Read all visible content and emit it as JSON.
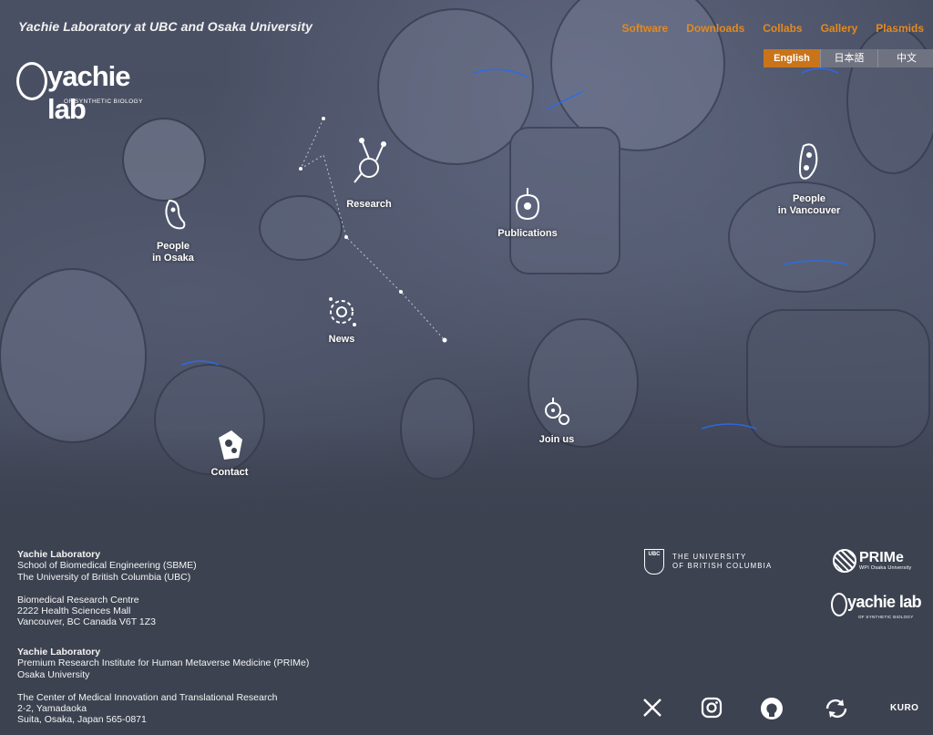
{
  "header": {
    "site_title": "Yachie Laboratory at UBC and Osaka University",
    "logo_word": "yachie lab",
    "logo_sub": "OF SYNTHETIC BIOLOGY"
  },
  "nav": {
    "items": [
      "Software",
      "Downloads",
      "Collabs",
      "Gallery",
      "Plasmids"
    ],
    "accent": "#e38a1f"
  },
  "languages": {
    "items": [
      "English",
      "日本語",
      "中文"
    ],
    "selected": "English"
  },
  "hotspots": {
    "research": "Research",
    "publications": "Publications",
    "people_vancouver_1": "People",
    "people_vancouver_2": "in Vancouver",
    "people_osaka_1": "People",
    "people_osaka_2": "in Osaka",
    "news": "News",
    "join": "Join us",
    "contact": "Contact"
  },
  "footer": {
    "ubc_block": {
      "name": "Yachie Laboratory",
      "line1": "School of Biomedical Engineering (SBME)",
      "line2": "The University of British Columbia (UBC)",
      "line3": "Biomedical Research Centre",
      "line4": "2222 Health Sciences Mall",
      "line5": "Vancouver, BC Canada V6T 1Z3"
    },
    "osaka_block": {
      "name": "Yachie Laboratory",
      "line1": "Premium Research Institute for Human Metaverse Medicine (PRIMe)",
      "line2": "Osaka University",
      "line3": "The Center of Medical Innovation and Translational Research",
      "line4": "2-2, Yamadaoka",
      "line5": "Suita, Osaka, Japan 565-0871"
    },
    "ubc_logo_1": "THE UNIVERSITY",
    "ubc_logo_2": "OF BRITISH COLUMBIA",
    "ubc_shield": "UBC",
    "prime_name": "PRIMe",
    "prime_sub": "WPI Osaka University",
    "lab_logo_word": "yachie lab",
    "lab_logo_sub": "OF SYNTHETIC BIOLOGY",
    "social": [
      "x-icon",
      "instagram-icon",
      "github-icon",
      "refresh-icon"
    ],
    "kuro": "KURO"
  }
}
